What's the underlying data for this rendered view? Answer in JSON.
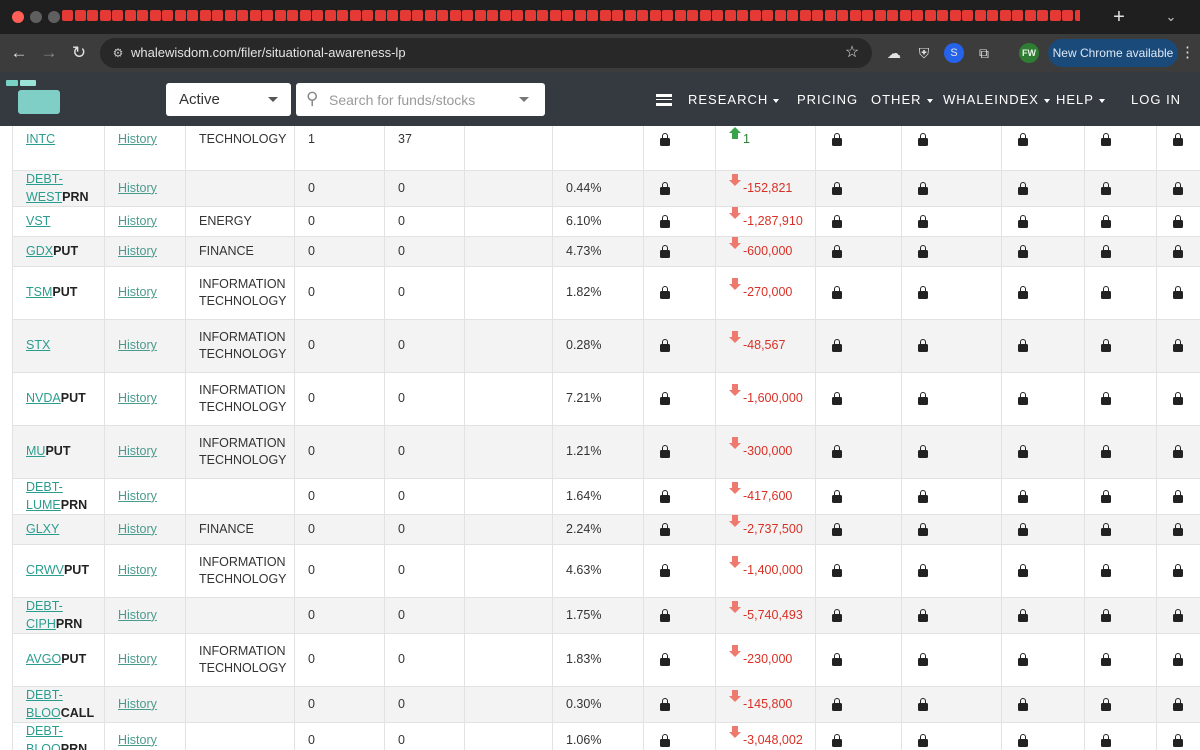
{
  "browser": {
    "url": "whalewisdom.com/filer/situational-awareness-lp",
    "new_tab_symbol": "+",
    "update_label": "New Chrome available",
    "profile_initials": "FW"
  },
  "header": {
    "status_value": "Active",
    "search_placeholder": "Search for funds/stocks",
    "nav": {
      "research": "RESEARCH",
      "pricing": "PRICING",
      "other": "OTHER",
      "whaleindex": "WHALEINDEX",
      "help": "HELP",
      "login": "LOG IN"
    }
  },
  "colors": {
    "header_bg": "#353a41",
    "link": "#2a9d8f",
    "negative": "#d93025",
    "positive": "#2e7d32"
  },
  "table": {
    "history_label": "History",
    "rows": [
      {
        "symbol": "INTC",
        "suffix": "",
        "sector": "TECHNOLOGY",
        "col4": "1",
        "col5": "37",
        "pct": "",
        "change": "1",
        "direction": "up"
      },
      {
        "symbol": "DEBT-WEST",
        "suffix": "PRN",
        "sector": "",
        "col4": "0",
        "col5": "0",
        "pct": "0.44%",
        "change": "-152,821",
        "direction": "down"
      },
      {
        "symbol": "VST",
        "suffix": "",
        "sector": "ENERGY",
        "col4": "0",
        "col5": "0",
        "pct": "6.10%",
        "change": "-1,287,910",
        "direction": "down"
      },
      {
        "symbol": "GDX",
        "suffix": "PUT",
        "sector": "FINANCE",
        "col4": "0",
        "col5": "0",
        "pct": "4.73%",
        "change": "-600,000",
        "direction": "down"
      },
      {
        "symbol": "TSM",
        "suffix": "PUT",
        "sector": "INFORMATION TECHNOLOGY",
        "col4": "0",
        "col5": "0",
        "pct": "1.82%",
        "change": "-270,000",
        "direction": "down"
      },
      {
        "symbol": "STX",
        "suffix": "",
        "sector": "INFORMATION TECHNOLOGY",
        "col4": "0",
        "col5": "0",
        "pct": "0.28%",
        "change": "-48,567",
        "direction": "down"
      },
      {
        "symbol": "NVDA",
        "suffix": "PUT",
        "sector": "INFORMATION TECHNOLOGY",
        "col4": "0",
        "col5": "0",
        "pct": "7.21%",
        "change": "-1,600,000",
        "direction": "down"
      },
      {
        "symbol": "MU",
        "suffix": "PUT",
        "sector": "INFORMATION TECHNOLOGY",
        "col4": "0",
        "col5": "0",
        "pct": "1.21%",
        "change": "-300,000",
        "direction": "down"
      },
      {
        "symbol": "DEBT-LUME",
        "suffix": "PRN",
        "sector": "",
        "col4": "0",
        "col5": "0",
        "pct": "1.64%",
        "change": "-417,600",
        "direction": "down"
      },
      {
        "symbol": "GLXY",
        "suffix": "",
        "sector": "FINANCE",
        "col4": "0",
        "col5": "0",
        "pct": "2.24%",
        "change": "-2,737,500",
        "direction": "down"
      },
      {
        "symbol": "CRWV",
        "suffix": "PUT",
        "sector": "INFORMATION TECHNOLOGY",
        "col4": "0",
        "col5": "0",
        "pct": "4.63%",
        "change": "-1,400,000",
        "direction": "down"
      },
      {
        "symbol": "DEBT-CIPH",
        "suffix": "PRN",
        "sector": "",
        "col4": "0",
        "col5": "0",
        "pct": "1.75%",
        "change": "-5,740,493",
        "direction": "down"
      },
      {
        "symbol": "AVGO",
        "suffix": "PUT",
        "sector": "INFORMATION TECHNOLOGY",
        "col4": "0",
        "col5": "0",
        "pct": "1.83%",
        "change": "-230,000",
        "direction": "down"
      },
      {
        "symbol": "DEBT-BLOO",
        "suffix": "CALL",
        "sector": "",
        "col4": "0",
        "col5": "0",
        "pct": "0.30%",
        "change": "-145,800",
        "direction": "down"
      },
      {
        "symbol": "DEBT-BLOO",
        "suffix": "PRN",
        "sector": "",
        "col4": "0",
        "col5": "0",
        "pct": "1.06%",
        "change": "-3,048,002",
        "direction": "down"
      }
    ]
  }
}
